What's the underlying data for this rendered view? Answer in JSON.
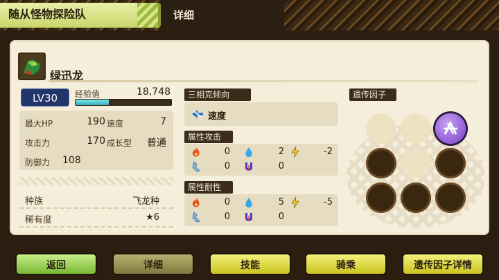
{
  "header": {
    "app_title": "随从怪物探险队",
    "section_title": "详细"
  },
  "monster": {
    "icon": "monster-portrait",
    "name": "绿迅龙",
    "level": "LV30",
    "exp_label": "经验值",
    "exp_value": "18,748",
    "exp_progress": 0.35
  },
  "stats": {
    "hp_label": "最大HP",
    "hp": "190",
    "speed_label": "速度",
    "speed": "7",
    "attack_label": "攻击力",
    "attack": "170",
    "growth_label": "成长型",
    "growth": "普通",
    "defense_label": "防御力",
    "defense": "108"
  },
  "info": {
    "species_label": "种族",
    "species": "飞龙种",
    "rarity_label": "稀有度",
    "rarity": "★6"
  },
  "tendency": {
    "header": "三相克倾向",
    "icon": "speed-icon",
    "value": "速度"
  },
  "attack_elements": {
    "header": "属性攻击",
    "fire": "0",
    "water": "2",
    "thunder": "-2",
    "ice": "0",
    "dragon": "0"
  },
  "resist_elements": {
    "header": "属性耐性",
    "fire": "0",
    "water": "5",
    "thunder": "-5",
    "ice": "0",
    "dragon": "0"
  },
  "genes": {
    "header": "遗传因子",
    "slots": [
      "empty",
      "empty",
      "skill",
      "dark",
      "empty",
      "dark",
      "dark",
      "dark",
      "dark"
    ]
  },
  "buttons": {
    "back": "返回",
    "detail": "详细",
    "skills": "技能",
    "ride": "骑乘",
    "gene_detail": "遗传因子详情"
  },
  "colors": {
    "accent_green": "#7ab834",
    "accent_yellow": "#cbc420",
    "panel_bg": "#f5eedb",
    "level_badge": "#22356a"
  }
}
